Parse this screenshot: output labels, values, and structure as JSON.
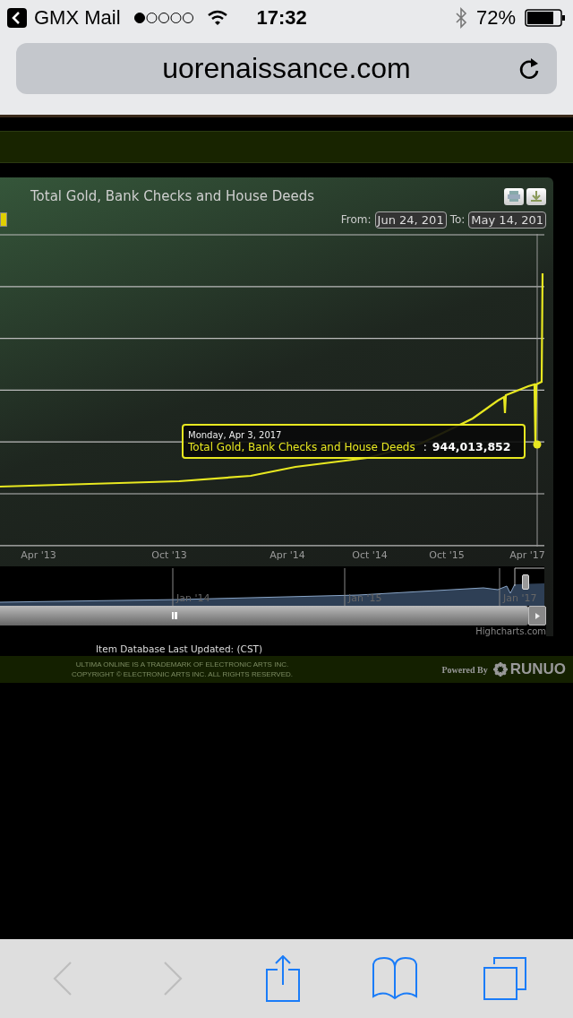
{
  "status_bar": {
    "back_app": "GMX Mail",
    "time": "17:32",
    "battery": "72%"
  },
  "address_bar": {
    "url": "uorenaissance.com"
  },
  "chart": {
    "title": "Total Gold, Bank Checks and House Deeds",
    "from_label": "From:",
    "from_value": "Jun 24, 201",
    "to_label": "To:",
    "to_value": "May 14, 201",
    "x_labels": [
      "Apr '13",
      "Oct '13",
      "Apr '14",
      "Oct '14",
      "Oct '15",
      "Apr '17"
    ],
    "tooltip": {
      "date": "Monday, Apr 3, 2017",
      "series": "Total Gold, Bank Checks and House Deeds",
      "separator": ":",
      "value": "944,013,852"
    },
    "navigator_labels": [
      "Jan '14",
      "Jan '15",
      "Jan '17"
    ],
    "credit": "Highcharts.com"
  },
  "footer": {
    "updated": "Item Database Last Updated: (CST)",
    "legal": [
      "ULTIMA ONLINE IS A TRADEMARK OF ELECTRONIC ARTS INC.",
      "COPYRIGHT © ELECTRONIC ARTS INC. ALL RIGHTS RESERVED."
    ],
    "powered": "Powered By",
    "brand": "RUNUO"
  },
  "toolbar": [
    {
      "kind": "back",
      "disabled": true
    },
    {
      "kind": "forward",
      "disabled": true
    },
    {
      "kind": "share",
      "disabled": false
    },
    {
      "kind": "bookmarks",
      "disabled": false
    },
    {
      "kind": "tabs",
      "disabled": false
    }
  ]
}
